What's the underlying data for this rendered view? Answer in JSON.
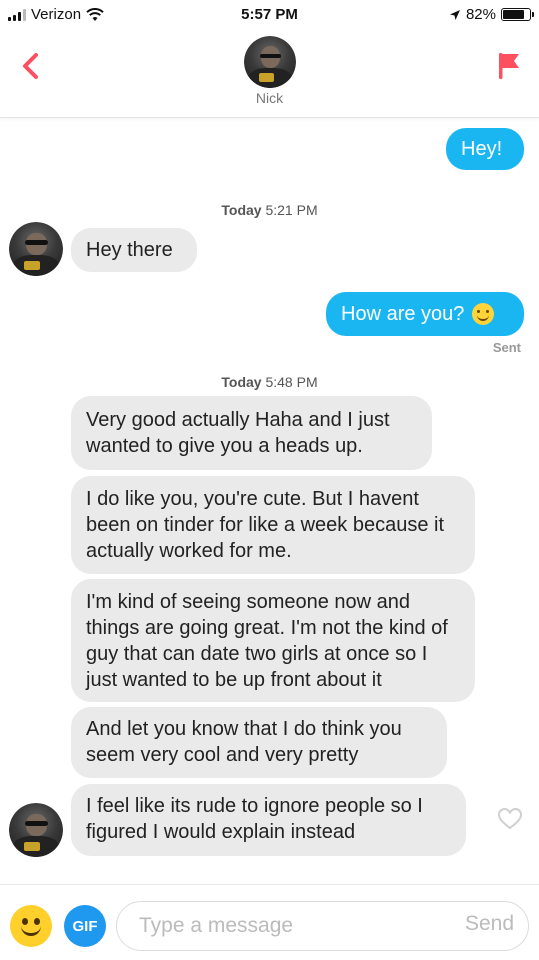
{
  "status_bar": {
    "carrier": "Verizon",
    "time": "5:57 PM",
    "battery_percent": "82%",
    "battery_level": 0.82
  },
  "header": {
    "contact_name": "Nick"
  },
  "icons": {
    "back": "chevron-left-icon",
    "report": "flag-icon",
    "like": "heart-icon",
    "wifi": "wifi-icon",
    "location": "location-arrow-icon"
  },
  "colors": {
    "accent": "#fd4f60",
    "outgoing_bubble": "#1ab6f1",
    "incoming_bubble": "#eaeaea",
    "gif_button": "#1f98f0",
    "emoji_button": "#ffcf2b"
  },
  "messages": {
    "m1": "Hey!",
    "ts1_day": "Today",
    "ts1_time": "5:21 PM",
    "m2": "Hey there",
    "m3": "How are you?",
    "m3_status": "Sent",
    "ts2_day": "Today",
    "ts2_time": "5:48 PM",
    "m4": "Very good actually Haha and I just wanted to give you a heads up.",
    "m5": "I do like you, you're cute. But I havent been on tinder for like a week because it actually worked for me.",
    "m6": "I'm kind of seeing someone now and things are going great. I'm not the kind of guy that can date two girls at once so I just wanted to be up front about it",
    "m7": "And let you know that I do think you seem very cool and very pretty",
    "m8": "I feel like its rude to ignore people so I figured I would explain instead"
  },
  "composer": {
    "gif_label": "GIF",
    "placeholder": "Type a message",
    "send_label": "Send",
    "value": ""
  }
}
